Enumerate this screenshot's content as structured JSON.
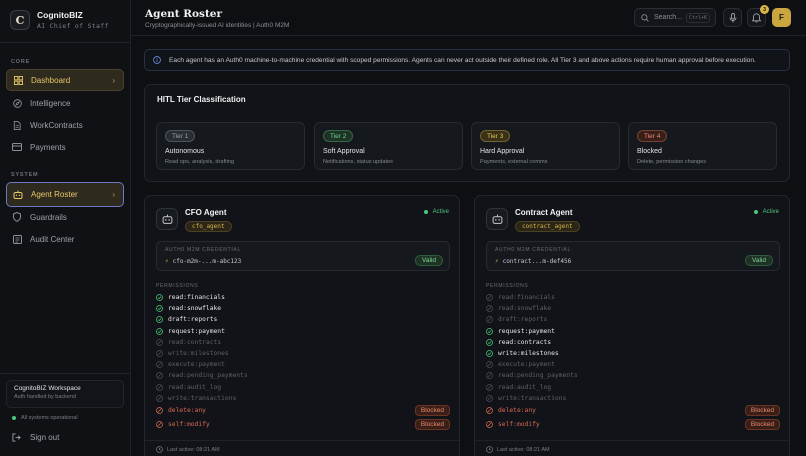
{
  "brand": {
    "name": "CognitoBIZ",
    "subtitle": "AI Chief of Staff",
    "logo_letter": "C"
  },
  "sidebar": {
    "sections": [
      {
        "label": "CORE",
        "items": [
          {
            "label": "Dashboard",
            "icon": "grid-icon",
            "state": "active"
          },
          {
            "label": "Intelligence",
            "icon": "compass-icon"
          },
          {
            "label": "WorkContracts",
            "icon": "document-icon"
          },
          {
            "label": "Payments",
            "icon": "card-icon"
          }
        ]
      },
      {
        "label": "SYSTEM",
        "items": [
          {
            "label": "Agent Roster",
            "icon": "robot-icon",
            "state": "selected"
          },
          {
            "label": "Guardrails",
            "icon": "shield-icon"
          },
          {
            "label": "Audit Center",
            "icon": "list-icon"
          }
        ]
      }
    ],
    "workspace": {
      "title": "CognitoBIZ Workspace",
      "subtitle": "Auth handled by backend"
    },
    "system_status": "All systems operational",
    "signout_label": "Sign out"
  },
  "header": {
    "title": "Agent Roster",
    "subtitle": "Cryptographically-issued AI identities | Auth0 M2M",
    "search_placeholder": "Search...",
    "search_shortcut": "Ctrl+K",
    "notification_count": "3",
    "avatar_letter": "F"
  },
  "info_banner": "Each agent has an Auth0 machine-to-machine credential with scoped permissions. Agents can never act outside their defined role. All Tier 3 and above actions require human approval before execution.",
  "tiers": {
    "title": "HITL Tier Classification",
    "items": [
      {
        "badge": "Tier 1",
        "name": "Autonomous",
        "desc": "Read ops, analysis, drafting",
        "color": "#9aa0a8",
        "bg": "#2a2d33"
      },
      {
        "badge": "Tier 2",
        "name": "Soft Approval",
        "desc": "Notifications, status updates",
        "color": "#6fd08f",
        "bg": "#1d3325"
      },
      {
        "badge": "Tier 3",
        "name": "Hard Approval",
        "desc": "Payments, external comms",
        "color": "#e2c35a",
        "bg": "#3a3218"
      },
      {
        "badge": "Tier 4",
        "name": "Blocked",
        "desc": "Delete, permission changes",
        "color": "#e88a6e",
        "bg": "#3a1f18"
      }
    ]
  },
  "agents": [
    {
      "name": "CFO Agent",
      "key": "cfo_agent",
      "status": "Active",
      "credential_label": "AUTH0 M2M CREDENTIAL",
      "credential": "cfo-m2m-...m-abc123",
      "credential_status": "Valid",
      "permissions_label": "PERMISSIONS",
      "permissions": [
        {
          "name": "read:financials",
          "state": "granted"
        },
        {
          "name": "read:snowflake",
          "state": "granted"
        },
        {
          "name": "draft:reports",
          "state": "granted"
        },
        {
          "name": "request:payment",
          "state": "granted"
        },
        {
          "name": "read:contracts",
          "state": "denied"
        },
        {
          "name": "write:milestones",
          "state": "denied"
        },
        {
          "name": "execute:payment",
          "state": "denied"
        },
        {
          "name": "read:pending_payments",
          "state": "denied"
        },
        {
          "name": "read:audit_log",
          "state": "denied"
        },
        {
          "name": "write:transactions",
          "state": "denied"
        },
        {
          "name": "delete:any",
          "state": "blocked"
        },
        {
          "name": "self:modify",
          "state": "blocked"
        }
      ],
      "last_active": "Last active: 08:21 AM"
    },
    {
      "name": "Contract Agent",
      "key": "contract_agent",
      "status": "Active",
      "credential_label": "AUTH0 M2M CREDENTIAL",
      "credential": "contract...m-def456",
      "credential_status": "Valid",
      "permissions_label": "PERMISSIONS",
      "permissions": [
        {
          "name": "read:financials",
          "state": "denied"
        },
        {
          "name": "read:snowflake",
          "state": "denied"
        },
        {
          "name": "draft:reports",
          "state": "denied"
        },
        {
          "name": "request:payment",
          "state": "granted"
        },
        {
          "name": "read:contracts",
          "state": "granted"
        },
        {
          "name": "write:milestones",
          "state": "granted"
        },
        {
          "name": "execute:payment",
          "state": "denied"
        },
        {
          "name": "read:pending_payments",
          "state": "denied"
        },
        {
          "name": "read:audit_log",
          "state": "denied"
        },
        {
          "name": "write:transactions",
          "state": "denied"
        },
        {
          "name": "delete:any",
          "state": "blocked"
        },
        {
          "name": "self:modify",
          "state": "blocked"
        }
      ],
      "last_active": "Last active: 08:21 AM"
    }
  ],
  "blocked_label": "Blocked"
}
